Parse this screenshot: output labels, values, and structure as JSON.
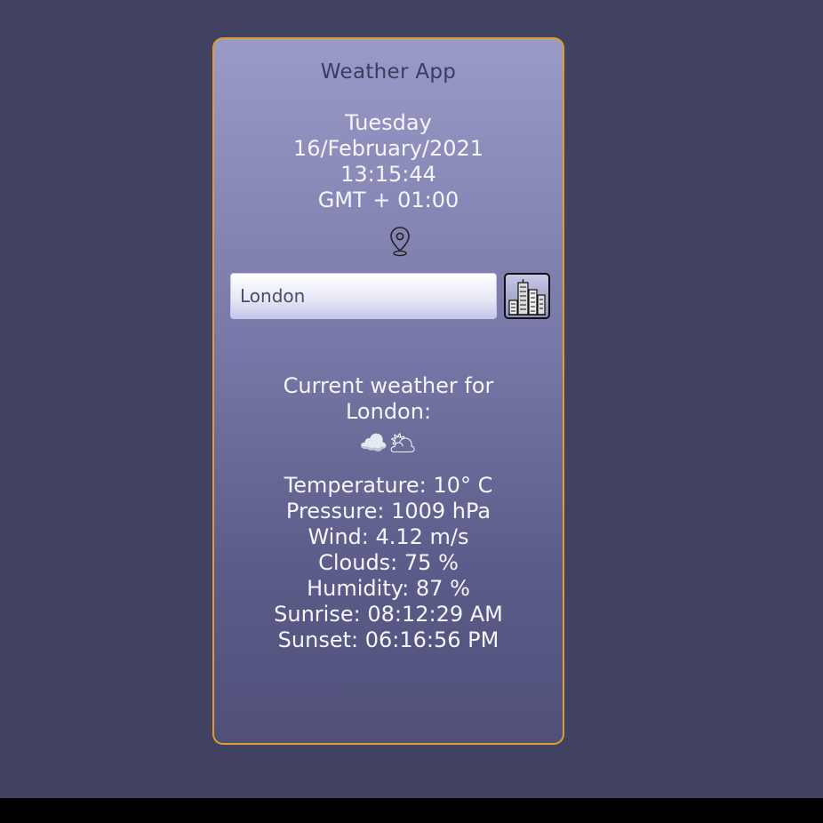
{
  "app": {
    "title": "Weather App"
  },
  "datetime": {
    "day": "Tuesday",
    "date": "16/February/2021",
    "time": "13:15:44",
    "timezone": "GMT + 01:00"
  },
  "search": {
    "value": "London",
    "button_icon": "city-buildings-icon"
  },
  "current": {
    "label_line1": "Current weather for",
    "label_line2": "London:",
    "icon": "☁️🌥",
    "temperature": "Temperature: 10° C",
    "pressure": "Pressure: 1009 hPa",
    "wind": "Wind: 4.12 m/s",
    "clouds": "Clouds: 75 %",
    "humidity": "Humidity: 87 %",
    "sunrise": "Sunrise: 08:12:29 AM",
    "sunset": "Sunset: 06:16:56 PM"
  },
  "colors": {
    "background": "#414162",
    "card_border": "#e59b2a",
    "card_gradient_top": "#9a9ac8",
    "card_gradient_bottom": "#4f4f79"
  }
}
